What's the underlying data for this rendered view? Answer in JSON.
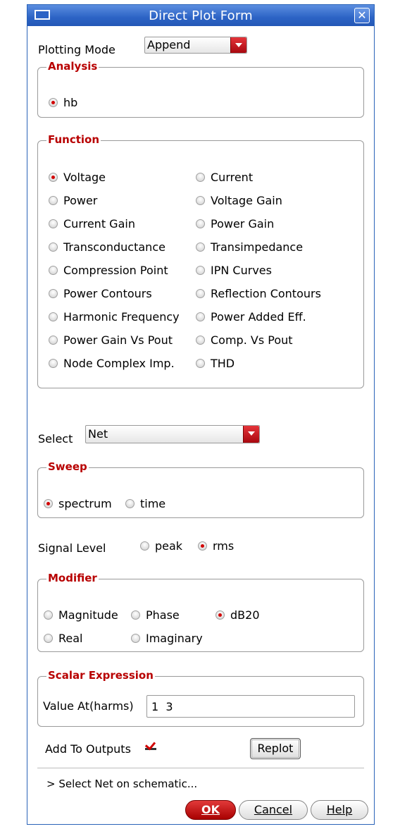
{
  "window": {
    "title": "Direct Plot Form"
  },
  "plotting_mode": {
    "label": "Plotting Mode",
    "value": "Append"
  },
  "analysis": {
    "title": "Analysis",
    "options": [
      {
        "label": "hb",
        "selected": true
      }
    ]
  },
  "function": {
    "title": "Function",
    "options": [
      {
        "label": "Voltage",
        "selected": true
      },
      {
        "label": "Current",
        "selected": false
      },
      {
        "label": "Power",
        "selected": false
      },
      {
        "label": "Voltage Gain",
        "selected": false
      },
      {
        "label": "Current Gain",
        "selected": false
      },
      {
        "label": "Power Gain",
        "selected": false
      },
      {
        "label": "Transconductance",
        "selected": false
      },
      {
        "label": "Transimpedance",
        "selected": false
      },
      {
        "label": "Compression Point",
        "selected": false
      },
      {
        "label": "IPN Curves",
        "selected": false
      },
      {
        "label": "Power Contours",
        "selected": false
      },
      {
        "label": "Reflection Contours",
        "selected": false
      },
      {
        "label": "Harmonic Frequency",
        "selected": false
      },
      {
        "label": "Power Added Eff.",
        "selected": false
      },
      {
        "label": "Power Gain Vs Pout",
        "selected": false
      },
      {
        "label": "Comp. Vs Pout",
        "selected": false
      },
      {
        "label": "Node Complex Imp.",
        "selected": false
      },
      {
        "label": "THD",
        "selected": false
      }
    ]
  },
  "select": {
    "label": "Select",
    "value": "Net"
  },
  "sweep": {
    "title": "Sweep",
    "options": [
      {
        "label": "spectrum",
        "selected": true
      },
      {
        "label": "time",
        "selected": false
      }
    ]
  },
  "signal_level": {
    "label": "Signal Level",
    "options": [
      {
        "label": "peak",
        "selected": false
      },
      {
        "label": "rms",
        "selected": true
      }
    ]
  },
  "modifier": {
    "title": "Modifier",
    "options": [
      {
        "label": "Magnitude",
        "selected": false
      },
      {
        "label": "Phase",
        "selected": false
      },
      {
        "label": "dB20",
        "selected": true
      },
      {
        "label": "Real",
        "selected": false
      },
      {
        "label": "Imaginary",
        "selected": false
      }
    ]
  },
  "scalar_expression": {
    "title": "Scalar Expression",
    "label": "Value At(harms)",
    "value": "1  3"
  },
  "add_to_outputs": {
    "label": "Add To Outputs",
    "checked": true
  },
  "replot_label": "Replot",
  "status_text": "> Select Net on schematic...",
  "buttons": {
    "ok": "OK",
    "cancel": "Cancel",
    "help": "Help"
  },
  "colors": {
    "titlebar": "#2c63c5",
    "accent_red": "#b80000"
  }
}
